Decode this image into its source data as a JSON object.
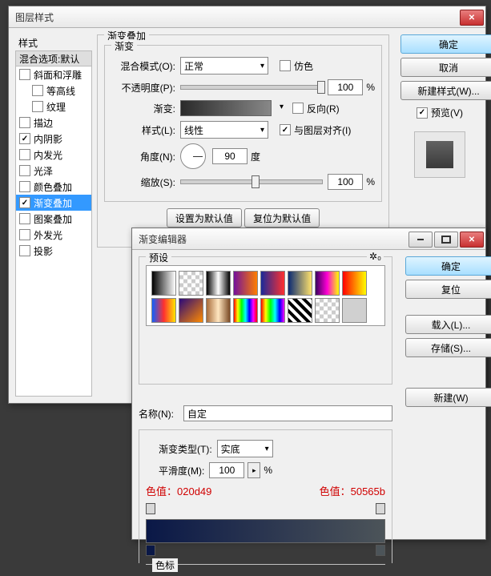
{
  "layerStyle": {
    "title": "图层样式",
    "stylesTitle": "样式",
    "blendHeader": "混合选项:默认",
    "items": [
      {
        "label": "斜面和浮雕",
        "checked": false,
        "indent": 0
      },
      {
        "label": "等高线",
        "checked": false,
        "indent": 1
      },
      {
        "label": "纹理",
        "checked": false,
        "indent": 1
      },
      {
        "label": "描边",
        "checked": false,
        "indent": 0
      },
      {
        "label": "内阴影",
        "checked": true,
        "indent": 0
      },
      {
        "label": "内发光",
        "checked": false,
        "indent": 0
      },
      {
        "label": "光泽",
        "checked": false,
        "indent": 0
      },
      {
        "label": "颜色叠加",
        "checked": false,
        "indent": 0
      },
      {
        "label": "渐变叠加",
        "checked": true,
        "indent": 0,
        "selected": true
      },
      {
        "label": "图案叠加",
        "checked": false,
        "indent": 0
      },
      {
        "label": "外发光",
        "checked": false,
        "indent": 0
      },
      {
        "label": "投影",
        "checked": false,
        "indent": 0
      }
    ],
    "sectionTitle": "渐变叠加",
    "sectionSub": "渐变",
    "blendModeLabel": "混合模式(O):",
    "blendMode": "正常",
    "dither": "仿色",
    "opacityLabel": "不透明度(P):",
    "opacity": "100",
    "pct": "%",
    "gradLabel": "渐变:",
    "reverse": "反向(R)",
    "styleLabel": "样式(L):",
    "styleVal": "线性",
    "align": "与图层对齐(I)",
    "angleLabel": "角度(N):",
    "angle": "90",
    "deg": "度",
    "scaleLabel": "缩放(S):",
    "scale": "100",
    "setDefault": "设置为默认值",
    "resetDefault": "复位为默认值",
    "ok": "确定",
    "cancel": "取消",
    "newStyle": "新建样式(W)...",
    "preview": "预览(V)"
  },
  "editor": {
    "title": "渐变编辑器",
    "presets": "预设",
    "ok": "确定",
    "reset": "复位",
    "load": "载入(L)...",
    "save": "存储(S)...",
    "new": "新建(W)",
    "nameLabel": "名称(N):",
    "nameVal": "自定",
    "typeLabel": "渐变类型(T):",
    "typeVal": "实底",
    "smoothLabel": "平滑度(M):",
    "smoothVal": "100",
    "pct": "%",
    "annotLeft": "色值：020d49",
    "annotRight": "色值：50565b",
    "stopsTitle": "色标",
    "presetStyles": [
      "linear-gradient(90deg,#000,#fff)",
      "repeating-conic-gradient(#ccc 0 25%,#fff 0 50%) 0/10px 10px",
      "linear-gradient(90deg,#000,#fff,#000)",
      "linear-gradient(90deg,#73109a,#ff7e00)",
      "linear-gradient(90deg,#1a2a99,#ff3030)",
      "linear-gradient(90deg,#0b2a72,#ffe26c)",
      "linear-gradient(90deg,#3a0060,#ff00d5,#ffff00)",
      "linear-gradient(90deg,#ff0000,#fffd00)",
      "linear-gradient(90deg,#1060ff,#ff3030,#ffe600)",
      "linear-gradient(135deg,#2a097a,#ff8a00)",
      "linear-gradient(90deg,#a86c3a,#ffe6c0,#7a4a24)",
      "linear-gradient(90deg,#ff0000,#ffff00,#00ff00,#00ffff,#0000ff,#ff00ff,#ff0000)",
      "linear-gradient(90deg,#f00,#ff0,#0f0,#0ff,#00f,#f0f)",
      "repeating-linear-gradient(45deg,#000 0 4px,#fff 4px 8px)",
      "repeating-conic-gradient(#ccc 0 25%,#fff 0 50%) 0/10px 10px",
      "#d0d0d0"
    ]
  }
}
